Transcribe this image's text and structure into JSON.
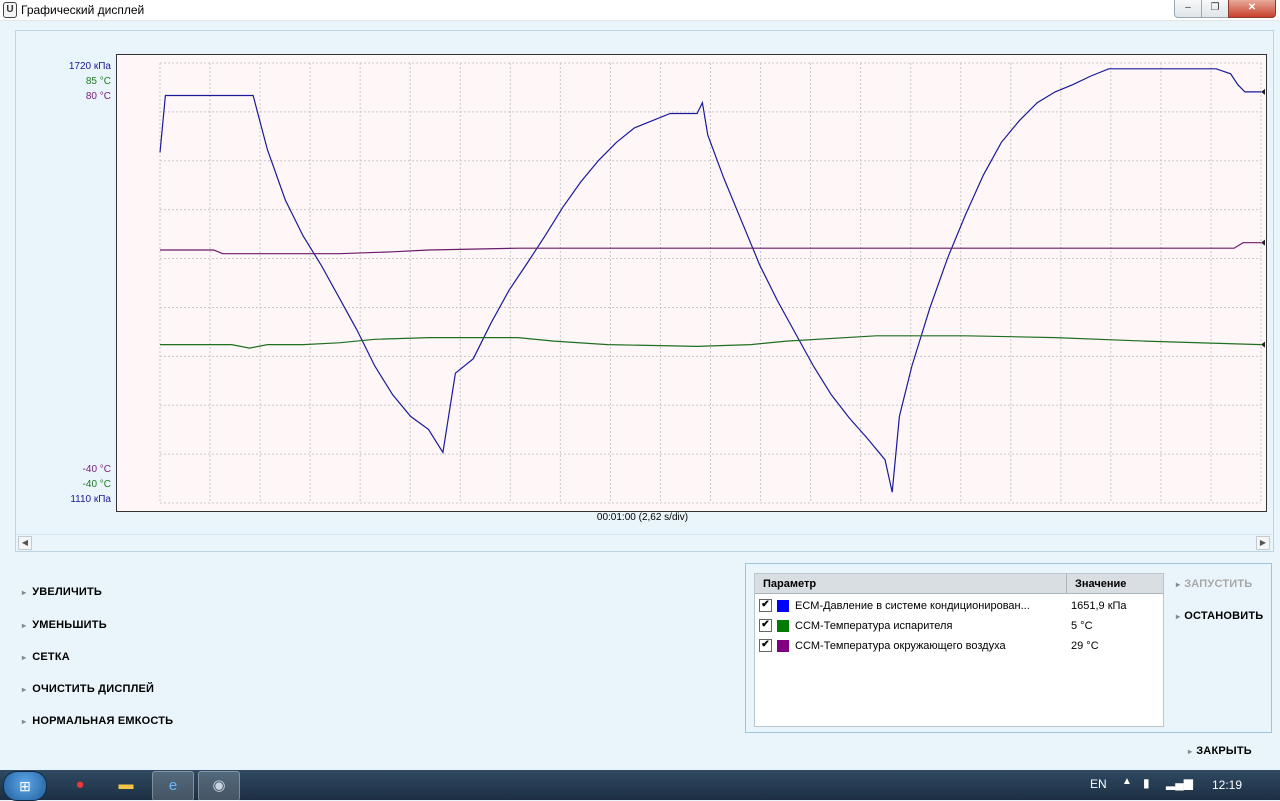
{
  "window": {
    "title": "Графический дисплей",
    "minimize": "–",
    "maximize": "❐",
    "close": "✕"
  },
  "graph": {
    "time_label": "00:01:00 (2,62 s/div)",
    "left_axis_top": [
      "1720 кПа",
      "85 °C",
      "80 °C"
    ],
    "left_axis_bottom": [
      "-40 °C",
      "-40 °C",
      "1110 кПа"
    ],
    "axis_colors": [
      "#1a1a9a",
      "#1f7a1f",
      "#7a1a7a"
    ],
    "grid": true,
    "series": [
      {
        "name": "ECM-Давление в системе кондиционирован...",
        "color": "#1a1a9a",
        "unit": "кПа",
        "min": 1110,
        "max": 1720,
        "points": [
          [
            0,
            1596
          ],
          [
            0.3,
            1675
          ],
          [
            5.2,
            1675
          ],
          [
            6,
            1600
          ],
          [
            7,
            1530
          ],
          [
            8,
            1480
          ],
          [
            9,
            1440
          ],
          [
            10,
            1395
          ],
          [
            11,
            1350
          ],
          [
            12,
            1300
          ],
          [
            13,
            1260
          ],
          [
            14,
            1230
          ],
          [
            15,
            1212
          ],
          [
            15.8,
            1180
          ],
          [
            16.5,
            1290
          ],
          [
            17.5,
            1310
          ],
          [
            18.5,
            1360
          ],
          [
            19.5,
            1405
          ],
          [
            20.5,
            1442
          ],
          [
            21.5,
            1480
          ],
          [
            22.5,
            1520
          ],
          [
            23.5,
            1555
          ],
          [
            24.5,
            1585
          ],
          [
            25.5,
            1610
          ],
          [
            26.5,
            1630
          ],
          [
            27.5,
            1640
          ],
          [
            28.5,
            1650
          ],
          [
            29.5,
            1650
          ],
          [
            30,
            1650
          ],
          [
            30.3,
            1665
          ],
          [
            30.6,
            1620
          ],
          [
            31.5,
            1560
          ],
          [
            32.5,
            1500
          ],
          [
            33.5,
            1440
          ],
          [
            34.5,
            1390
          ],
          [
            35.5,
            1345
          ],
          [
            36.5,
            1300
          ],
          [
            37.5,
            1260
          ],
          [
            38.5,
            1228
          ],
          [
            39.5,
            1200
          ],
          [
            40.5,
            1170
          ],
          [
            40.9,
            1125
          ],
          [
            41.3,
            1230
          ],
          [
            42,
            1300
          ],
          [
            43,
            1380
          ],
          [
            44,
            1450
          ],
          [
            45,
            1510
          ],
          [
            46,
            1565
          ],
          [
            47,
            1610
          ],
          [
            48,
            1640
          ],
          [
            49,
            1665
          ],
          [
            50,
            1680
          ],
          [
            51,
            1690
          ],
          [
            52,
            1702
          ],
          [
            53,
            1712
          ],
          [
            54,
            1712
          ],
          [
            55,
            1712
          ],
          [
            56,
            1712
          ],
          [
            57,
            1712
          ],
          [
            58,
            1712
          ],
          [
            59,
            1712
          ],
          [
            59.8,
            1705
          ],
          [
            60.2,
            1690
          ],
          [
            60.6,
            1680
          ],
          [
            61.5,
            1680
          ]
        ]
      },
      {
        "name": "CCM-Температура испарителя",
        "color": "#1f6e1f",
        "unit": "°C",
        "min": -40,
        "max": 85,
        "points": [
          [
            0,
            5
          ],
          [
            4,
            5
          ],
          [
            5,
            4
          ],
          [
            6,
            5
          ],
          [
            8,
            5
          ],
          [
            10,
            5.5
          ],
          [
            12,
            6.5
          ],
          [
            15,
            7
          ],
          [
            20,
            7
          ],
          [
            22,
            6
          ],
          [
            25,
            5
          ],
          [
            30,
            4.5
          ],
          [
            33,
            5
          ],
          [
            35,
            6
          ],
          [
            40,
            7.5
          ],
          [
            42,
            7.5
          ],
          [
            45,
            7.5
          ],
          [
            50,
            7
          ],
          [
            55,
            6
          ],
          [
            61.5,
            5
          ]
        ]
      },
      {
        "name": "CCM-Температура окружающего воздуха",
        "color": "#6a1a6a",
        "unit": "°C",
        "min": -40,
        "max": 80,
        "points": [
          [
            0,
            29
          ],
          [
            3,
            29
          ],
          [
            3.5,
            28
          ],
          [
            10,
            28
          ],
          [
            13,
            28.5
          ],
          [
            15,
            29
          ],
          [
            20,
            29.5
          ],
          [
            30,
            29.5
          ],
          [
            40,
            29.5
          ],
          [
            50,
            29.5
          ],
          [
            60,
            29.5
          ],
          [
            60.5,
            31
          ],
          [
            61.5,
            31
          ]
        ]
      }
    ],
    "x_max": 61.5
  },
  "commands": {
    "zoom_in": "УВЕЛИЧИТЬ",
    "zoom_out": "УМЕНЬШИТЬ",
    "grid": "СЕТКА",
    "clear": "ОЧИСТИТЬ ДИСПЛЕЙ",
    "normal": "НОРМАЛЬНАЯ ЕМКОСТЬ",
    "start": "ЗАПУСТИТЬ",
    "stop": "ОСТАНОВИТЬ",
    "close": "ЗАКРЫТЬ"
  },
  "table": {
    "headers": {
      "param": "Параметр",
      "value": "Значение"
    },
    "rows": [
      {
        "checked": "✔",
        "color": "#0000ff",
        "name": "ECM-Давление в системе кондиционирован...",
        "value": "1651,9 кПа"
      },
      {
        "checked": "✔",
        "color": "#007a00",
        "name": "CCM-Температура испарителя",
        "value": "5 °C"
      },
      {
        "checked": "✔",
        "color": "#800080",
        "name": "CCM-Температура окружающего воздуха",
        "value": "29 °C"
      }
    ]
  },
  "taskbar": {
    "lang": "EN",
    "time": "12:19"
  }
}
